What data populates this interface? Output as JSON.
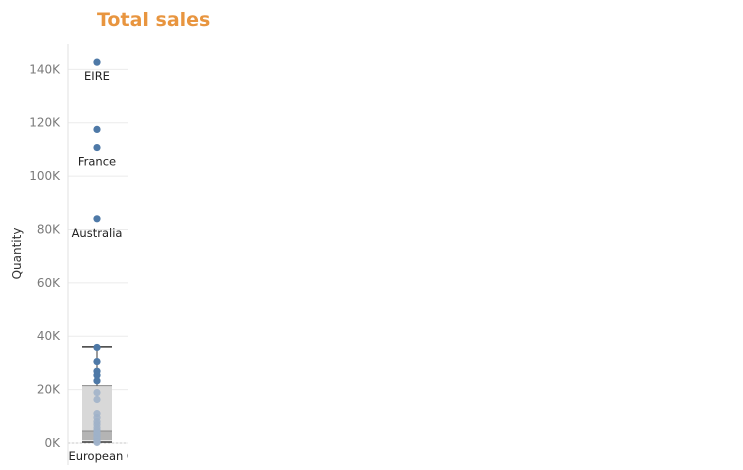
{
  "chart_data": {
    "type": "scatter",
    "subtype": "box-and-whisker",
    "title": "Total sales",
    "ylabel": "Quantity",
    "xlabel": "",
    "ylim": [
      0,
      150000
    ],
    "yticks": [
      0,
      20000,
      40000,
      60000,
      80000,
      100000,
      120000,
      140000
    ],
    "ytick_labels": [
      "0K",
      "20K",
      "40K",
      "60K",
      "80K",
      "100K",
      "120K",
      "140K"
    ],
    "grid": true,
    "categories": [
      "European C"
    ],
    "series": [
      {
        "values": [
          142700,
          117500,
          110700,
          84000,
          35800,
          30500,
          26900,
          25400,
          23300,
          18900,
          16300,
          11000,
          9500,
          8000,
          7000,
          5800,
          4800,
          4000,
          3500,
          3000,
          2500,
          2000,
          1500,
          1000,
          500,
          200
        ],
        "labels": [
          "EIRE",
          "",
          "France",
          "Australia",
          "",
          "",
          "",
          "",
          "",
          "",
          "",
          "",
          "",
          "",
          "",
          "",
          "",
          "",
          "",
          "",
          "",
          "",
          "",
          "",
          "",
          ""
        ]
      }
    ],
    "box": {
      "whisker_low": 0,
      "q1": 1000,
      "median": 4500,
      "q3": 21500,
      "whisker_high": 36000
    },
    "colors": {
      "title": "#e8953f",
      "point": "#4e79a7",
      "point_muted": "#9fb1c9",
      "box_fill": "#d8d8d8",
      "box_lower_fill": "#b4b4b4",
      "whisker": "#3a3a3a",
      "grid": "#ebebeb"
    }
  }
}
